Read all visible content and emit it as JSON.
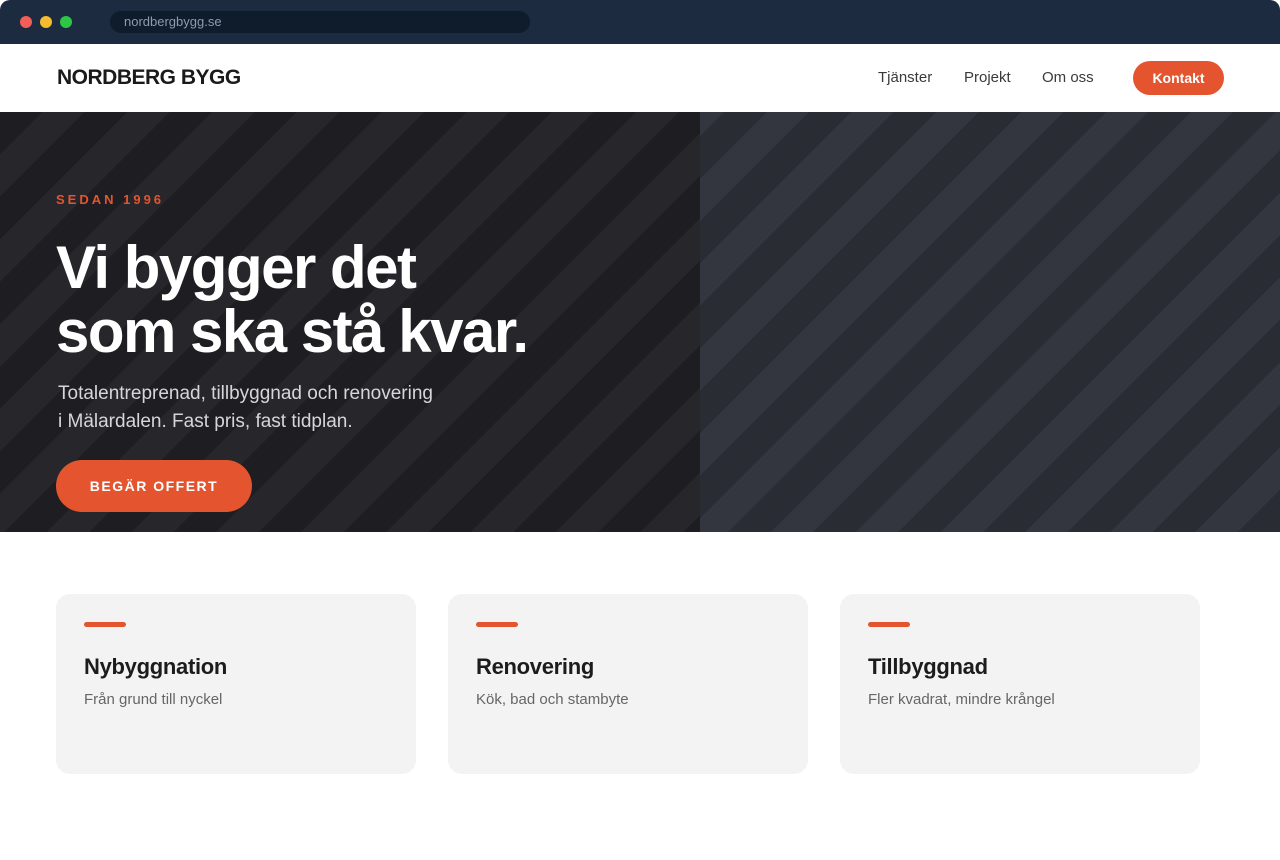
{
  "browser": {
    "url": "nordbergbygg.se"
  },
  "header": {
    "logo": "NORDBERG BYGG",
    "nav": [
      "Tjänster",
      "Projekt",
      "Om oss"
    ],
    "contact_label": "Kontakt"
  },
  "hero": {
    "eyebrow": "SEDAN 1996",
    "headline_line1": "Vi bygger det",
    "headline_line2": "som ska stå kvar.",
    "subtext_line1": "Totalentreprenad, tillbyggnad och renovering",
    "subtext_line2": "i Mälardalen. Fast pris, fast tidplan.",
    "cta_label": "BEGÄR OFFERT"
  },
  "services": [
    {
      "title": "Nybyggnation",
      "desc": "Från grund till nyckel"
    },
    {
      "title": "Renovering",
      "desc": "Kök, bad och stambyte"
    },
    {
      "title": "Tillbyggnad",
      "desc": "Fler kvadrat, mindre krångel"
    }
  ],
  "colors": {
    "accent": "#e4552f",
    "hero_dark": "#1e1e22",
    "chrome": "#1c2b3f"
  }
}
